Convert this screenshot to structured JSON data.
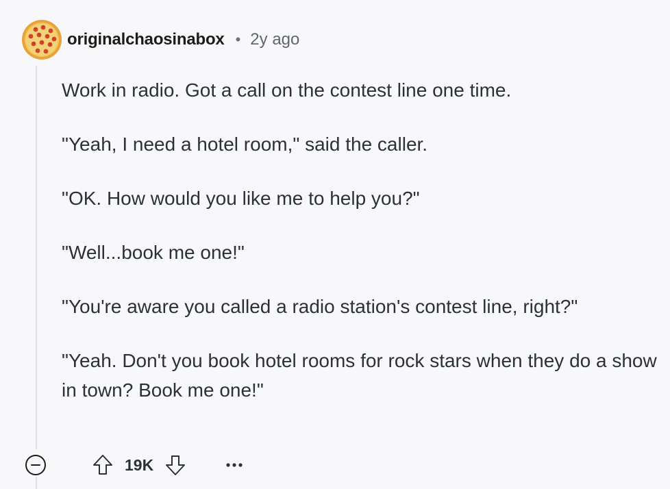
{
  "comment": {
    "username": "originalchaosinabox",
    "separator": "•",
    "timestamp": "2y ago",
    "paragraphs": [
      "Work in radio. Got a call on the contest line one time.",
      "\"Yeah, I need a hotel room,\" said the caller.",
      "\"OK. How would you like me to help you?\"",
      "\"Well...book me one!\"",
      "\"You're aware you called a radio station's contest line, right?\"",
      "\"Yeah. Don't you book hotel rooms for rock stars when they do a show in town? Book me one!\""
    ]
  },
  "actions": {
    "score": "19K",
    "collapse_icon": "collapse-minus-icon",
    "upvote_icon": "upvote-arrow-icon",
    "downvote_icon": "downvote-arrow-icon",
    "more_icon": "more-options-icon"
  },
  "colors": {
    "background": "#f8f8fa",
    "text": "#2a3236",
    "meta": "#5f676c",
    "thread_line": "#dfe3e6"
  }
}
